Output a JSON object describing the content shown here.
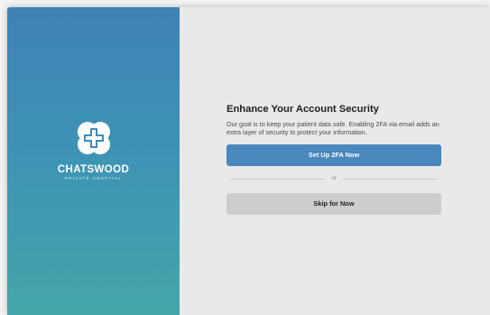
{
  "brand": {
    "name": "CHATSWOOD",
    "subtitle": "PRIVATE HOSPITAL",
    "logo_icon": "chatswood-cross-logo-icon"
  },
  "security_prompt": {
    "title": "Enhance Your Account Security",
    "description": "Our goal is to keep your patient data safe. Enabling 2FA via email adds an extra layer of security to protect your information.",
    "primary_button_label": "Set Up 2FA Now",
    "divider_label": "or",
    "secondary_button_label": "Skip for Now"
  },
  "colors": {
    "gradient_top": "#3f82b6",
    "gradient_bottom": "#45a6aa",
    "primary_button": "#4987bd",
    "secondary_button": "#cdcdcd",
    "content_background": "#e9e9e9"
  }
}
